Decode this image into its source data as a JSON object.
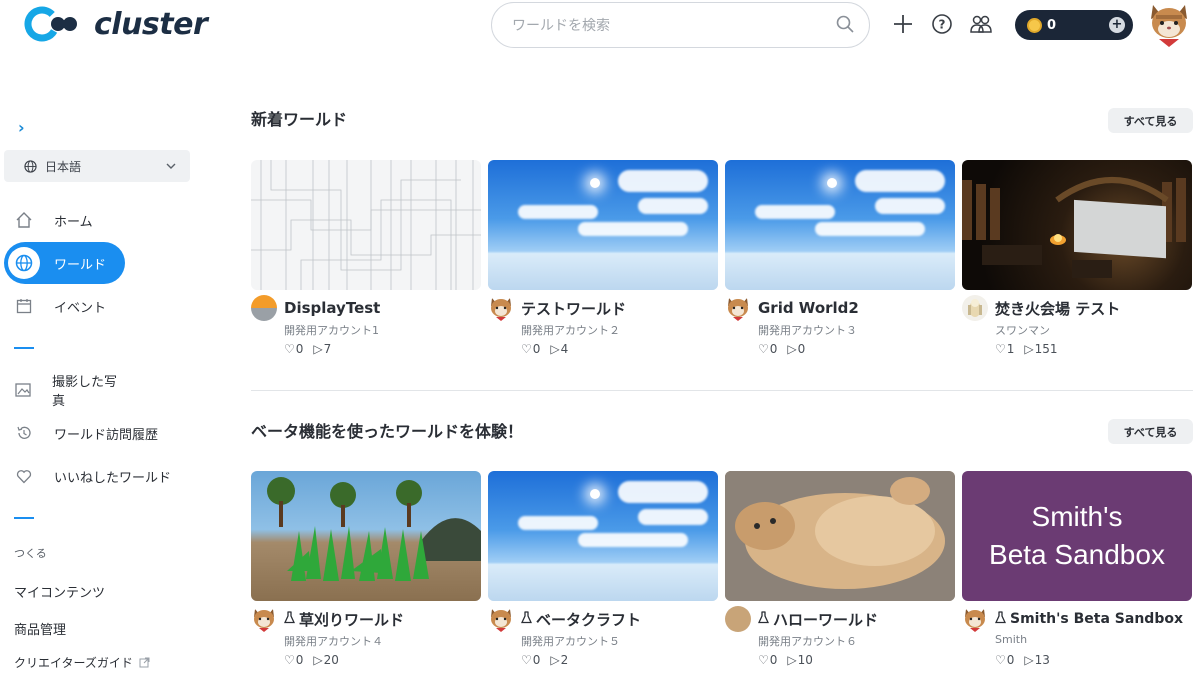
{
  "header": {
    "logo_text": "cluster",
    "search_placeholder": "ワールドを検索",
    "coin_value": "0"
  },
  "sidebar": {
    "language": "日本語",
    "nav": [
      {
        "label": "ホーム",
        "icon": "home-icon"
      },
      {
        "label": "ワールド",
        "icon": "globe-icon"
      },
      {
        "label": "イベント",
        "icon": "calendar-icon"
      }
    ],
    "links": [
      {
        "label": "撮影した写真",
        "icon": "photo-icon"
      },
      {
        "label": "ワールド訪問履歴",
        "icon": "history-icon"
      },
      {
        "label": "いいねしたワールド",
        "icon": "heart-icon"
      }
    ],
    "create_section": "つくる",
    "create_links": [
      "マイコンテンツ",
      "商品管理",
      "クリエイターズガイド"
    ]
  },
  "sections": [
    {
      "title": "新着ワールド",
      "see_all": "すべて見る",
      "cards": [
        {
          "title": "DisplayTest",
          "owner": "開発用アカウント1",
          "likes": "0",
          "plays": "7",
          "beta": false
        },
        {
          "title": "テストワールド",
          "owner": "開発用アカウント２",
          "likes": "0",
          "plays": "4",
          "beta": false
        },
        {
          "title": "Grid World2",
          "owner": "開発用アカウント３",
          "likes": "0",
          "plays": "0",
          "beta": false
        },
        {
          "title": "焚き火会場 テスト",
          "owner": "スワンマン",
          "likes": "1",
          "plays": "151",
          "beta": false
        }
      ]
    },
    {
      "title": "ベータ機能を使ったワールドを体験！",
      "see_all": "すべて見る",
      "cards": [
        {
          "title": "草刈りワールド",
          "owner": "開発用アカウント４",
          "likes": "0",
          "plays": "20",
          "beta": true
        },
        {
          "title": "ベータクラフト",
          "owner": "開発用アカウント５",
          "likes": "0",
          "plays": "2",
          "beta": true
        },
        {
          "title": "ハローワールド",
          "owner": "開発用アカウント６",
          "likes": "0",
          "plays": "10",
          "beta": true
        },
        {
          "title": "Smith's Beta Sandbox",
          "owner": "Smith",
          "likes": "0",
          "plays": "13",
          "beta": true,
          "thumb_line1": "Smith's",
          "thumb_line2": "Beta Sandbox"
        }
      ]
    }
  ],
  "colors": {
    "accent": "#1a8ef0",
    "brand_dark": "#1c2e44",
    "sandbox_purple": "#6b3b73"
  }
}
